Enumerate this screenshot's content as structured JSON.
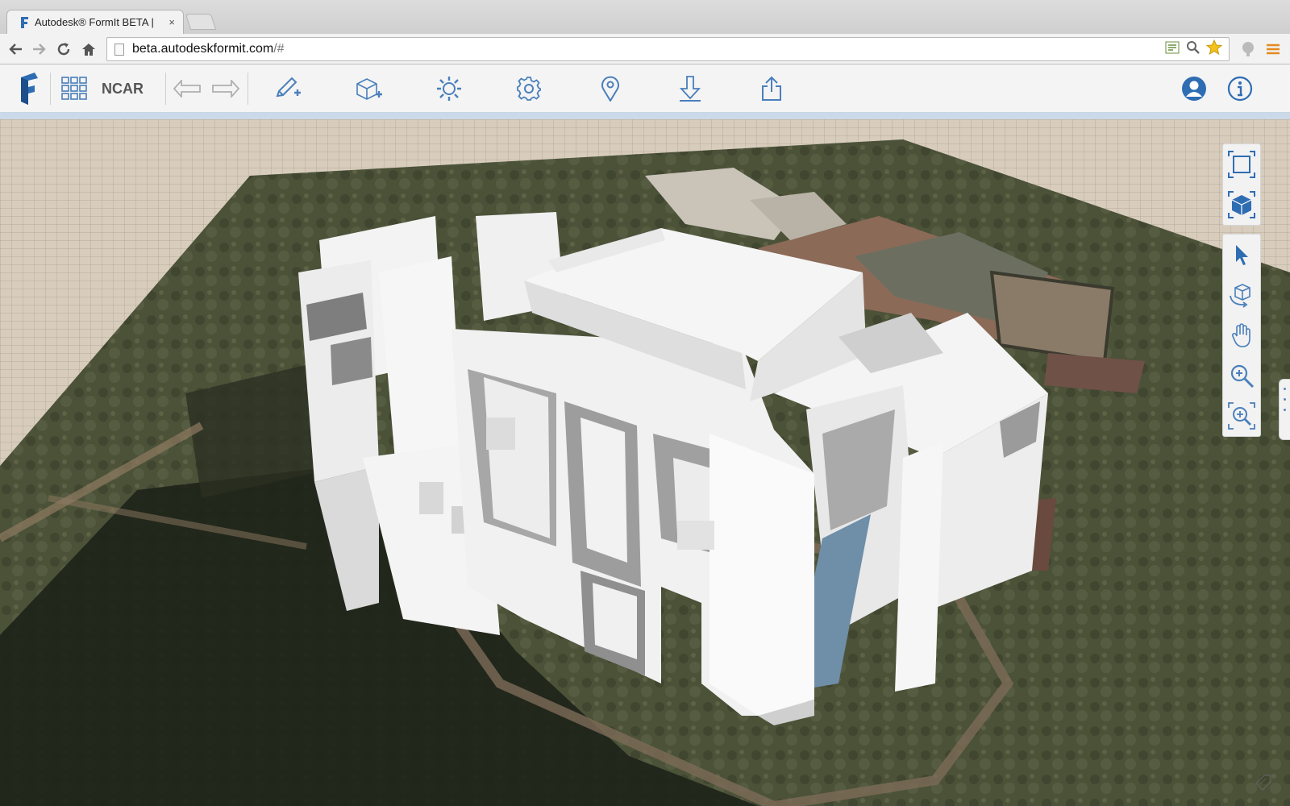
{
  "browser": {
    "tab_title": "Autodesk® FormIt BETA |",
    "tab_close": "×",
    "url_main": "beta.autodeskformit.com",
    "url_rest": "/#"
  },
  "toolbar": {
    "project_name": "NCAR",
    "buttons": [
      {
        "name": "formit-logo",
        "icon": "formit-logo-icon"
      },
      {
        "name": "grid-view",
        "icon": "grid-icon"
      },
      {
        "name": "undo",
        "icon": "undo-arrow-icon"
      },
      {
        "name": "redo",
        "icon": "redo-arrow-icon"
      },
      {
        "name": "sketch-tools",
        "icon": "pencil-plus-icon"
      },
      {
        "name": "add-geometry",
        "icon": "cube-plus-icon"
      },
      {
        "name": "sun-settings",
        "icon": "sun-icon"
      },
      {
        "name": "settings",
        "icon": "gear-icon"
      },
      {
        "name": "location",
        "icon": "map-pin-icon"
      },
      {
        "name": "import",
        "icon": "download-arrow-icon"
      },
      {
        "name": "export",
        "icon": "share-icon"
      },
      {
        "name": "user-account",
        "icon": "user-icon"
      },
      {
        "name": "info",
        "icon": "info-icon"
      }
    ]
  },
  "view_tools": [
    "frame-2d-icon",
    "cube-3d-icon"
  ],
  "nav_tools": [
    "select-pointer-icon",
    "orbit-icon",
    "pan-hand-icon",
    "zoom-icon",
    "zoom-extents-icon"
  ],
  "colors": {
    "accent": "#2f6db3",
    "toolbar_icon": "#4a7fbb",
    "terrain": "#4b5238",
    "building": "#f2f2f2",
    "shadow": "#1e2219"
  }
}
